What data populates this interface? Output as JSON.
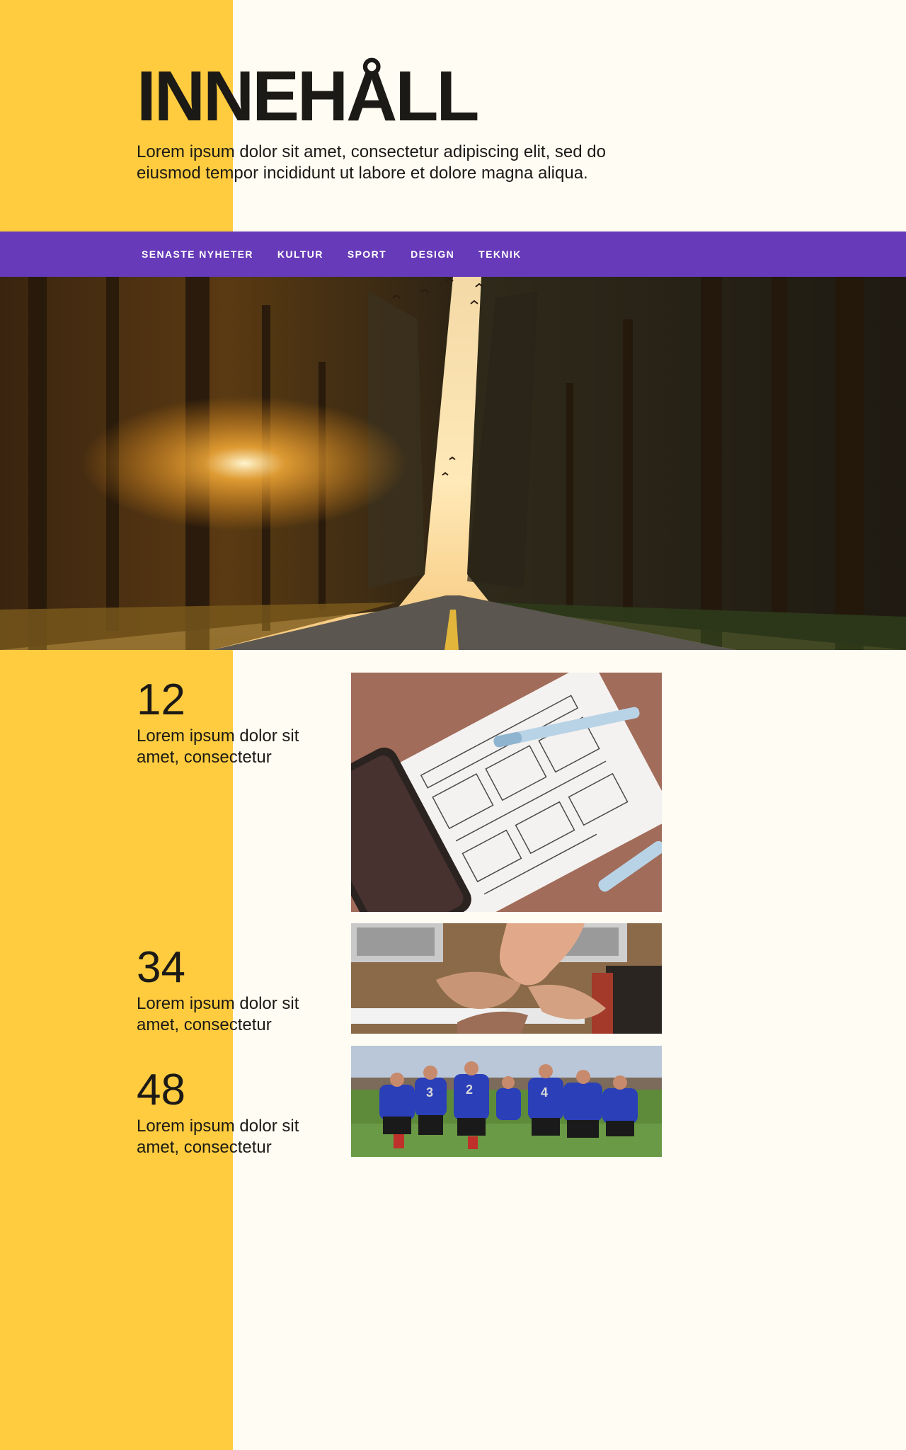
{
  "header": {
    "title": "INNEHÅLL",
    "intro_line1": "Lorem ipsum dolor sit amet, consectetur adipiscing elit, sed do",
    "intro_line2": "eiusmod tempor incididunt ut labore et dolore magna aliqua."
  },
  "nav": {
    "items": [
      {
        "label": "SENASTE NYHETER"
      },
      {
        "label": "KULTUR"
      },
      {
        "label": "SPORT"
      },
      {
        "label": "DESIGN"
      },
      {
        "label": "TEKNIK"
      }
    ]
  },
  "stats": [
    {
      "number": "12",
      "line1": "Lorem ipsum dolor sit",
      "line2": "amet, consectetur"
    },
    {
      "number": "34",
      "line1": "Lorem ipsum dolor sit",
      "line2": "amet, consectetur"
    },
    {
      "number": "48",
      "line1": "Lorem ipsum dolor sit",
      "line2": "amet, consectetur"
    }
  ],
  "colors": {
    "background": "#fffcf3",
    "accent_yellow": "#ffcc3f",
    "nav_purple": "#663ab8",
    "text": "#1c1a16"
  }
}
